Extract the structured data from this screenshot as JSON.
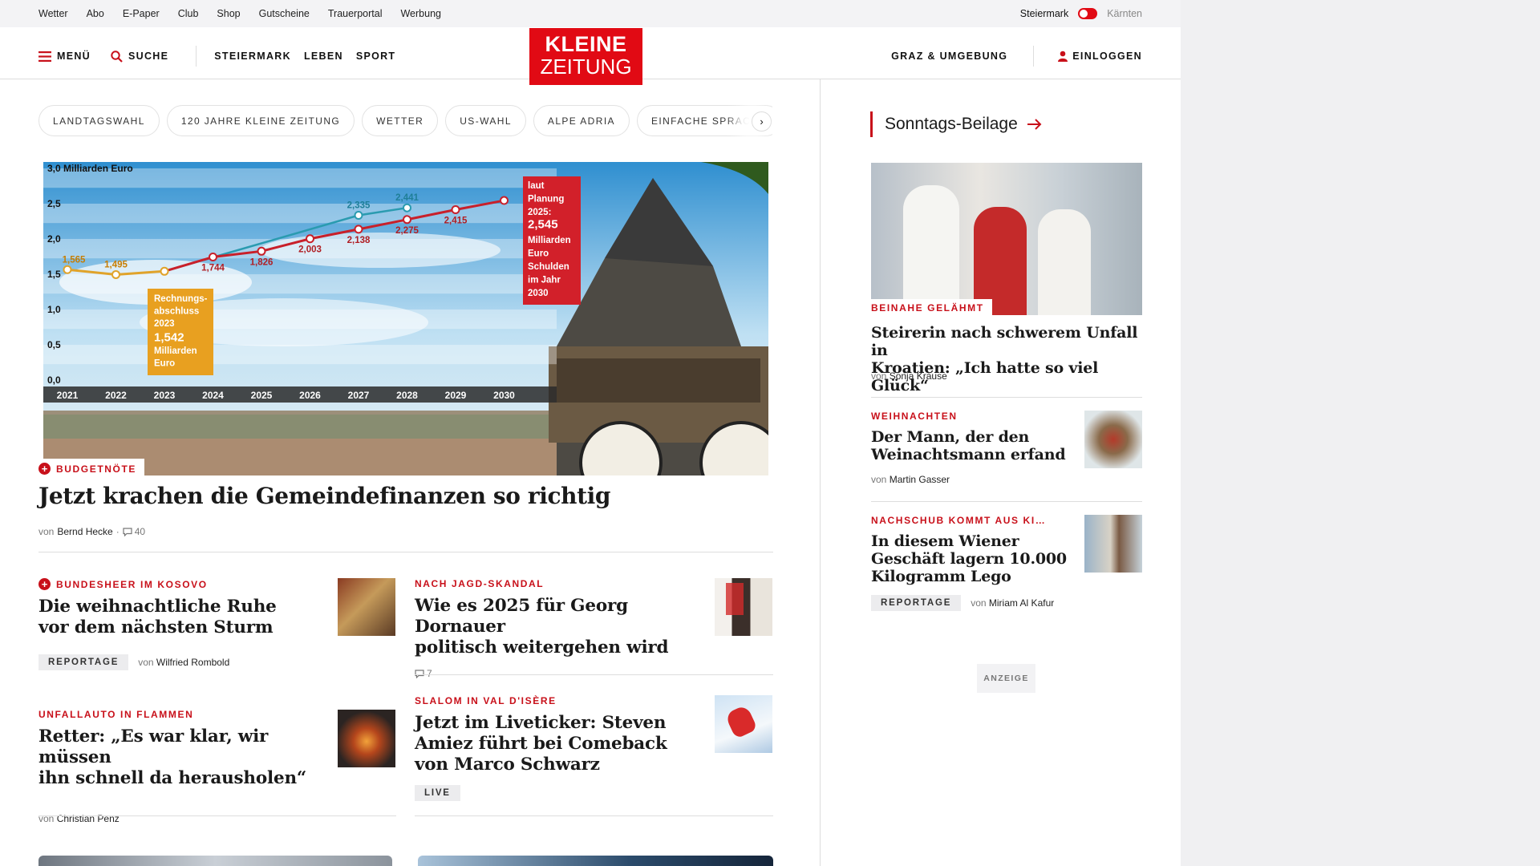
{
  "util": {
    "links": [
      "Wetter",
      "Abo",
      "E-Paper",
      "Club",
      "Shop",
      "Gutscheine",
      "Trauerportal",
      "Werbung"
    ],
    "region_active": "Steiermark",
    "region_inactive": "Kärnten"
  },
  "header": {
    "menu": "MENÜ",
    "search": "SUCHE",
    "nav": [
      "STEIERMARK",
      "LEBEN",
      "SPORT"
    ],
    "logo_line1": "KLEINE",
    "logo_line2": "ZEITUNG",
    "region": "GRAZ & UMGEBUNG",
    "login": "EINLOGGEN"
  },
  "chips": [
    "LANDTAGSWAHL",
    "120 JAHRE KLEINE ZEITUNG",
    "WETTER",
    "US-WAHL",
    "ALPE ADRIA",
    "EINFACHE SPRACHE"
  ],
  "hero": {
    "kicker": "BUDGETNÖTE",
    "title": "Jetzt krachen die Gemeindefinanzen so richtig",
    "by": "von",
    "author": "Bernd Hecke",
    "sep": "·",
    "comments": "40"
  },
  "hero_chart": {
    "unit": "3,0 Milliarden Euro",
    "yticks": [
      "3,0",
      "2,5",
      "2,0",
      "1,5",
      "1,0",
      "0,5",
      "0,0"
    ],
    "years": [
      "2021",
      "2022",
      "2023",
      "2024",
      "2025",
      "2026",
      "2027",
      "2028",
      "2029",
      "2030"
    ],
    "values": [
      {
        "year": 2021,
        "value": 1.565,
        "label": "1,565"
      },
      {
        "year": 2022,
        "value": 1.495,
        "label": "1,495"
      },
      {
        "year": 2023,
        "value": 1.542,
        "label": ""
      },
      {
        "year": 2024,
        "value": 1.744,
        "label": "1,744"
      },
      {
        "year": 2025,
        "value": 1.826,
        "label": "1,826"
      },
      {
        "year": 2026,
        "value": 2.003,
        "label": "2,003"
      },
      {
        "year": 2027,
        "value": 2.138,
        "label": "2,138"
      },
      {
        "year": 2028,
        "value": 2.275,
        "label": "2,275"
      },
      {
        "year": 2029,
        "value": 2.415,
        "label": "2,415"
      },
      {
        "year": 2030,
        "value": 2.545,
        "label": ""
      }
    ],
    "earlier": [
      {
        "year": 2027,
        "value": 2.335,
        "label": "2,335"
      },
      {
        "year": 2028,
        "value": 2.441,
        "label": "2,441"
      }
    ],
    "orange_box": [
      "Rechnungs-",
      "abschluss",
      "2023",
      "1,542",
      "Milliarden",
      "Euro"
    ],
    "red_box": [
      "laut",
      "Planung",
      "2025:",
      "2,545",
      "Milliarden",
      "Euro",
      "Schulden",
      "im Jahr",
      "2030"
    ]
  },
  "cards": [
    {
      "kicker": "BUNDESHEER IM KOSOVO",
      "title1": "Die weihnachtliche Ruhe",
      "title2": "vor dem nächsten Sturm",
      "badge": "REPORTAGE",
      "by": "von",
      "author": "Wilfried Rombold"
    },
    {
      "kicker": "NACH JAGD-SKANDAL",
      "title1": "Wie es 2025 für Georg Dornauer",
      "title2": "politisch weitergehen wird",
      "comments": "7"
    },
    {
      "kicker": "UNFALLAUTO IN FLAMMEN",
      "title1": "Retter: „Es war klar, wir müssen",
      "title2": "ihn schnell da herausholen“",
      "by": "von",
      "author": "Christian Penz"
    },
    {
      "kicker": "SLALOM IN VAL D'ISÈRE",
      "title1": "Jetzt im Liveticker: Steven",
      "title2": "Amiez führt bei Comeback",
      "title3": "von Marco Schwarz",
      "badge": "LIVE"
    }
  ],
  "sidebar": {
    "head": "Sonntags-Beilage",
    "items": [
      {
        "kicker": "BEINAHE GELÄHMT",
        "title1": "Steirerin nach schwerem Unfall in",
        "title2": "Kroatien: „Ich hatte so viel Glück“",
        "by": "von",
        "author": "Sonja Krause"
      },
      {
        "kicker": "WEIHNACHTEN",
        "title1": "Der Mann, der den",
        "title2": "Weinachtsmann erfand",
        "by": "von",
        "author": "Martin Gasser"
      },
      {
        "kicker": "NACHSCHUB KOMMT AUS KI…",
        "title1": "In diesem Wiener",
        "title2": "Geschäft lagern 10.000",
        "title3": "Kilogramm Lego",
        "badge": "REPORTAGE",
        "by": "von",
        "author": "Miriam Al Kafur"
      }
    ],
    "ad_label": "ANZEIGE"
  },
  "colors": {
    "brand_red": "#e10a14",
    "kicker_red": "#c8101a"
  }
}
